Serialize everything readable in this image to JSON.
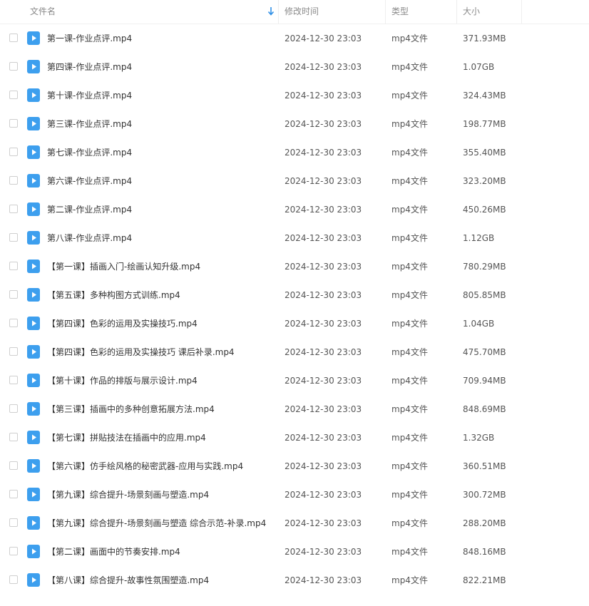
{
  "header": {
    "name": "文件名",
    "modified": "修改时间",
    "type": "类型",
    "size": "大小"
  },
  "colors": {
    "accent": "#3d9fee",
    "sort_arrow": "#2f8fe6"
  },
  "icons": {
    "file": "video-file-icon",
    "sort": "sort-desc-arrow-icon"
  },
  "files": [
    {
      "name": "第一课-作业点评.mp4",
      "modified": "2024-12-30 23:03",
      "type": "mp4文件",
      "size": "371.93MB"
    },
    {
      "name": "第四课-作业点评.mp4",
      "modified": "2024-12-30 23:03",
      "type": "mp4文件",
      "size": "1.07GB"
    },
    {
      "name": "第十课-作业点评.mp4",
      "modified": "2024-12-30 23:03",
      "type": "mp4文件",
      "size": "324.43MB"
    },
    {
      "name": "第三课-作业点评.mp4",
      "modified": "2024-12-30 23:03",
      "type": "mp4文件",
      "size": "198.77MB"
    },
    {
      "name": "第七课-作业点评.mp4",
      "modified": "2024-12-30 23:03",
      "type": "mp4文件",
      "size": "355.40MB"
    },
    {
      "name": "第六课-作业点评.mp4",
      "modified": "2024-12-30 23:03",
      "type": "mp4文件",
      "size": "323.20MB"
    },
    {
      "name": "第二课-作业点评.mp4",
      "modified": "2024-12-30 23:03",
      "type": "mp4文件",
      "size": "450.26MB"
    },
    {
      "name": "第八课-作业点评.mp4",
      "modified": "2024-12-30 23:03",
      "type": "mp4文件",
      "size": "1.12GB"
    },
    {
      "name": "【第一课】插画入门-绘画认知升级.mp4",
      "modified": "2024-12-30 23:03",
      "type": "mp4文件",
      "size": "780.29MB"
    },
    {
      "name": "【第五课】多种构图方式训练.mp4",
      "modified": "2024-12-30 23:03",
      "type": "mp4文件",
      "size": "805.85MB"
    },
    {
      "name": "【第四课】色彩的运用及实操技巧.mp4",
      "modified": "2024-12-30 23:03",
      "type": "mp4文件",
      "size": "1.04GB"
    },
    {
      "name": "【第四课】色彩的运用及实操技巧 课后补录.mp4",
      "modified": "2024-12-30 23:03",
      "type": "mp4文件",
      "size": "475.70MB"
    },
    {
      "name": "【第十课】作品的排版与展示设计.mp4",
      "modified": "2024-12-30 23:03",
      "type": "mp4文件",
      "size": "709.94MB"
    },
    {
      "name": "【第三课】插画中的多种创意拓展方法.mp4",
      "modified": "2024-12-30 23:03",
      "type": "mp4文件",
      "size": "848.69MB"
    },
    {
      "name": "【第七课】拼贴技法在插画中的应用.mp4",
      "modified": "2024-12-30 23:03",
      "type": "mp4文件",
      "size": "1.32GB"
    },
    {
      "name": "【第六课】仿手绘风格的秘密武器-应用与实践.mp4",
      "modified": "2024-12-30 23:03",
      "type": "mp4文件",
      "size": "360.51MB"
    },
    {
      "name": "【第九课】综合提升-场景刻画与塑造.mp4",
      "modified": "2024-12-30 23:03",
      "type": "mp4文件",
      "size": "300.72MB"
    },
    {
      "name": "【第九课】综合提升-场景刻画与塑造 综合示范-补录.mp4",
      "modified": "2024-12-30 23:03",
      "type": "mp4文件",
      "size": "288.20MB"
    },
    {
      "name": "【第二课】画面中的节奏安排.mp4",
      "modified": "2024-12-30 23:03",
      "type": "mp4文件",
      "size": "848.16MB"
    },
    {
      "name": "【第八课】综合提升-故事性氛围塑造.mp4",
      "modified": "2024-12-30 23:03",
      "type": "mp4文件",
      "size": "822.21MB"
    }
  ]
}
